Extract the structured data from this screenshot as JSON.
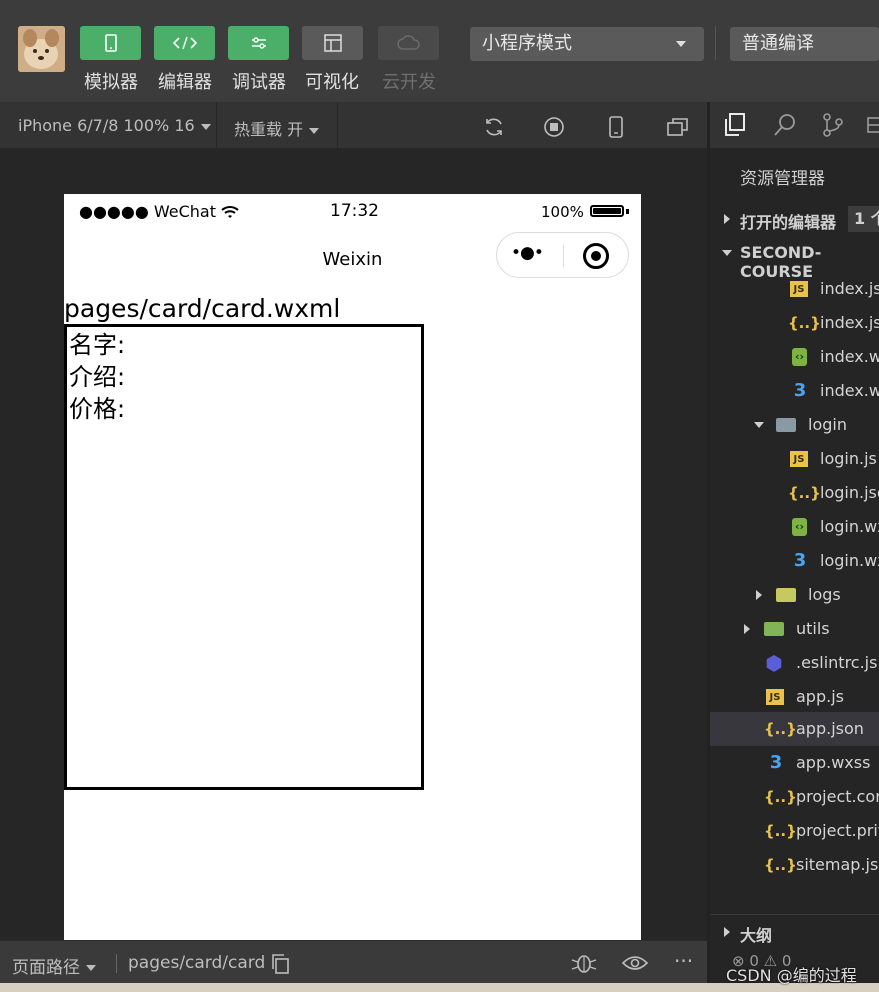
{
  "toolbar": {
    "buttons": [
      {
        "label": "模拟器",
        "icon": "phone-icon"
      },
      {
        "label": "编辑器",
        "icon": "code-icon"
      },
      {
        "label": "调试器",
        "icon": "sliders-icon"
      },
      {
        "label": "可视化",
        "icon": "layout-icon"
      },
      {
        "label": "云开发",
        "icon": "cloud-icon"
      }
    ],
    "mode_select": "小程序模式",
    "compile_select": "普通编译"
  },
  "subbar": {
    "device": "iPhone 6/7/8 100% 16",
    "hot_reload": "热重载 开"
  },
  "phone": {
    "signal": "●●●●● WeChat",
    "time": "17:32",
    "battery": "100%",
    "nav_title": "Weixin",
    "capsule_dots": "•●•",
    "page_path": "pages/card/card.wxml",
    "card_lines": [
      "名字:",
      "介绍:",
      "价格:"
    ]
  },
  "bottombar": {
    "path_label": "页面路径",
    "path_value": "pages/card/card"
  },
  "explorer": {
    "title": "资源管理器",
    "open_editors": "打开的编辑器",
    "open_count": "1 个",
    "project": "SECOND-COURSE",
    "files": [
      {
        "name": "index.js",
        "type": "js"
      },
      {
        "name": "index.json",
        "type": "json"
      },
      {
        "name": "index.wxml",
        "type": "wxml"
      },
      {
        "name": "index.wxss",
        "type": "css"
      },
      {
        "name": "login",
        "type": "folder-open"
      },
      {
        "name": "login.js",
        "type": "js"
      },
      {
        "name": "login.json",
        "type": "json"
      },
      {
        "name": "login.wxml",
        "type": "wxml"
      },
      {
        "name": "login.wxss",
        "type": "css"
      },
      {
        "name": "logs",
        "type": "folder"
      },
      {
        "name": "utils",
        "type": "folder"
      },
      {
        "name": ".eslintrc.js",
        "type": "eslint"
      },
      {
        "name": "app.js",
        "type": "js"
      },
      {
        "name": "app.json",
        "type": "json"
      },
      {
        "name": "app.wxss",
        "type": "css"
      },
      {
        "name": "project.config.json",
        "type": "json"
      },
      {
        "name": "project.private.config.json",
        "type": "json"
      },
      {
        "name": "sitemap.json",
        "type": "json"
      }
    ],
    "outline": "大纲",
    "problems": "⊗ 0 ⚠ 0"
  },
  "watermark": "CSDN @编的过程"
}
